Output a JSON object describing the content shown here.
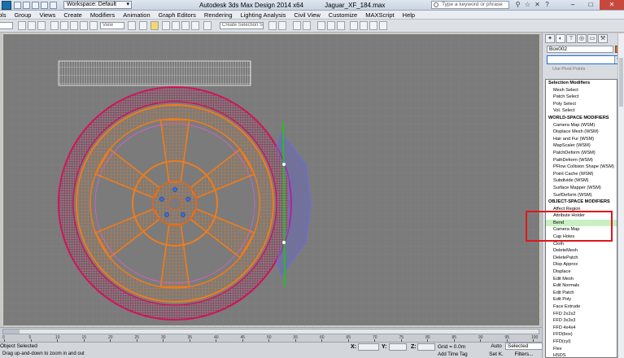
{
  "titlebar": {
    "workspace": "Workspace: Default",
    "app_title": "Autodesk 3ds Max Design 2014 x64",
    "file_name": "Jaguar_XF_184.max",
    "search_placeholder": "Type a keyword or phrase",
    "window_controls": [
      "minimize-icon",
      "maximize-icon",
      "close-icon"
    ]
  },
  "menubar": {
    "items": [
      "ols",
      "Group",
      "Views",
      "Create",
      "Modifiers",
      "Animation",
      "Graph Editors",
      "Rendering",
      "Lighting Analysis",
      "Civil View",
      "Customize",
      "MAXScript",
      "Help"
    ]
  },
  "toolbar": {
    "view_dropdown": "View",
    "named_selection_placeholder": "Create Selection S"
  },
  "command_panel": {
    "tabs": [
      "create-icon",
      "modify-icon",
      "hierarchy-icon",
      "motion-icon",
      "display-icon",
      "utilities-icon"
    ],
    "object_name": "Box002",
    "object_color": "#e86414",
    "modifier_list_value": "",
    "use_pivot_points": "Use Pivot Points"
  },
  "modifier_dropdown": {
    "items": [
      {
        "label": "Selection Modifiers",
        "header": true
      },
      {
        "label": "Mesh Select"
      },
      {
        "label": "Patch Select"
      },
      {
        "label": "Poly Select"
      },
      {
        "label": "Vol. Select"
      },
      {
        "label": "WORLD-SPACE MODIFIERS",
        "header": true
      },
      {
        "label": "Camera Map (WSM)"
      },
      {
        "label": "Displace Mesh (WSM)"
      },
      {
        "label": "Hair and Fur (WSM)"
      },
      {
        "label": "MapScaler (WSM)"
      },
      {
        "label": "PatchDeform (WSM)"
      },
      {
        "label": "PathDeform (WSM)"
      },
      {
        "label": "PFlow Collision Shape (WSM)"
      },
      {
        "label": "Point Cache (WSM)"
      },
      {
        "label": "Subdivide (WSM)"
      },
      {
        "label": "Surface Mapper (WSM)"
      },
      {
        "label": "SurfDeform (WSM)"
      },
      {
        "label": "OBJECT-SPACE MODIFIERS",
        "header": true
      },
      {
        "label": "Affect Region"
      },
      {
        "label": "Attribute Holder"
      },
      {
        "label": "Bend",
        "selected": true
      },
      {
        "label": "Camera Map"
      },
      {
        "label": "Cap Holes"
      },
      {
        "label": "Cloth"
      },
      {
        "label": "DeleteMesh"
      },
      {
        "label": "DeletePatch"
      },
      {
        "label": "Disp Approx"
      },
      {
        "label": "Displace"
      },
      {
        "label": "Edit Mesh"
      },
      {
        "label": "Edit Normals"
      },
      {
        "label": "Edit Patch"
      },
      {
        "label": "Edit Poly"
      },
      {
        "label": "Face Extrude"
      },
      {
        "label": "FFD 2x2x2"
      },
      {
        "label": "FFD 3x3x3"
      },
      {
        "label": "FFD 4x4x4"
      },
      {
        "label": "FFD(box)"
      },
      {
        "label": "FFD(cyl)"
      },
      {
        "label": "Flex"
      },
      {
        "label": "HSDS"
      }
    ]
  },
  "timeline": {
    "ticks": [
      "0",
      "5",
      "10",
      "15",
      "20",
      "25",
      "30",
      "35",
      "40",
      "45",
      "50",
      "55",
      "60",
      "65",
      "70",
      "75",
      "80",
      "85",
      "90",
      "95",
      "100"
    ]
  },
  "statusbar": {
    "selection": "Object Selected",
    "prompt": "Drag up-and-down to zoom in and out",
    "x_label": "X:",
    "y_label": "Y:",
    "z_label": "Z:",
    "grid": "Grid = 0.0m",
    "add_time_tag": "Add Time Tag",
    "auto": "Auto",
    "set_key": "Set K.",
    "selected_dropdown": "Selected",
    "filters": "Filters..."
  }
}
